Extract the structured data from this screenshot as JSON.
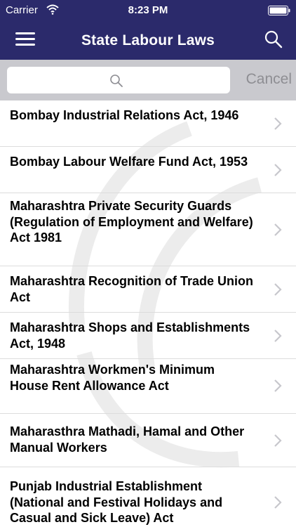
{
  "status_bar": {
    "carrier": "Carrier",
    "time": "8:23 PM"
  },
  "nav": {
    "title": "State Labour Laws"
  },
  "search": {
    "placeholder": "",
    "cancel_label": "Cancel"
  },
  "colors": {
    "nav_bg": "#2b2a6b",
    "search_row_bg": "#c9c9ce",
    "cancel": "#8e8e93"
  },
  "laws": [
    "Bombay Industrial Relations Act, 1946",
    "Bombay Labour Welfare Fund Act, 1953",
    "Maharashtra Private Security Guards (Regulation of Employment and Welfare) Act 1981",
    "Maharashtra Recognition of Trade Union Act",
    "Maharashtra Shops and Establishments Act, 1948",
    "Maharashtra Workmen's Minimum House Rent Allowance Act",
    "Maharasthra Mathadi, Hamal and Other Manual Workers",
    "Punjab Industrial Establishment (National and Festival Holidays and Casual and Sick Leave) Act"
  ]
}
